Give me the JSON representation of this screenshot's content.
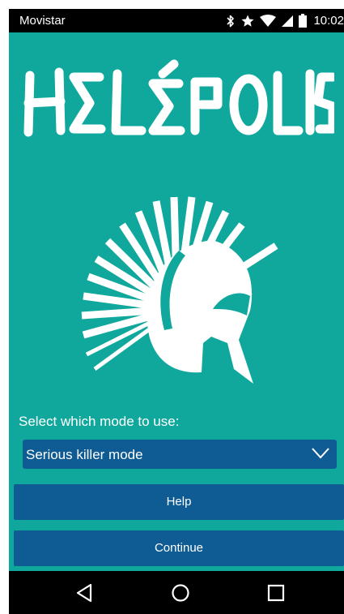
{
  "status_bar": {
    "carrier": "Movistar",
    "time": "10:02",
    "icons": [
      "bluetooth-icon",
      "star-icon",
      "wifi-icon",
      "signal-icon",
      "battery-icon"
    ]
  },
  "app": {
    "logo_text": "HELÉPOLIS",
    "logo_icon": "spartan-helmet-icon"
  },
  "mode": {
    "label": "Select which mode to use:",
    "selected": "Serious killer mode"
  },
  "buttons": {
    "help": "Help",
    "continue": "Continue"
  },
  "nav_bar": {
    "icons": [
      "back-icon",
      "home-icon",
      "recents-icon"
    ]
  },
  "colors": {
    "background": "#10a89c",
    "accent": "#0f5b94",
    "text": "#ffffff"
  }
}
